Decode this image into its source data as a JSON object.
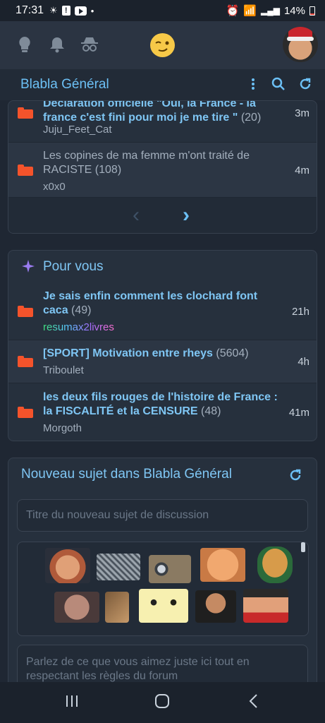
{
  "status_bar": {
    "time": "17:31",
    "battery": "14%",
    "left_icons": [
      "sun-icon",
      "alert-icon",
      "youtube-icon",
      "dot-icon"
    ],
    "right_icons": [
      "alarm-icon",
      "wifi-icon",
      "signal-icon",
      "battery-icon"
    ]
  },
  "top_nav": {
    "icons": [
      "lightbulb-icon",
      "bell-icon",
      "incognito-icon",
      "smiley-logo-icon",
      "avatar"
    ]
  },
  "header": {
    "title": "Blabla Général",
    "actions": [
      "more-vert-icon",
      "search-icon",
      "refresh-icon"
    ]
  },
  "forum_topics": {
    "items": [
      {
        "title_line1": "Déclaration officielle \"Oui, la France - la",
        "title_line2": "france c'est fini pour moi je me tire \"",
        "count": "(20)",
        "author": "Juju_Feet_Cat",
        "age": "3m",
        "read": false
      },
      {
        "title_line1": "Les copines de ma femme m'ont traité de",
        "title_line2": "RACISTE",
        "count": "(108)",
        "author": "x0x0",
        "age": "4m",
        "read": true
      }
    ],
    "pager": {
      "prev": "‹",
      "next": "›"
    }
  },
  "for_you": {
    "title": "Pour vous",
    "items": [
      {
        "title_line1": "Je sais enfin comment les clochard font",
        "title_line2": "caca",
        "count": "(49)",
        "author": "resumax2livres",
        "age": "21h"
      },
      {
        "title_line1": "[SPORT] Motivation entre rheys",
        "title_line2": "",
        "count": "(5604)",
        "author": "Triboulet",
        "age": "4h"
      },
      {
        "title_line1": "les deux fils rouges de l'histoire de France :",
        "title_line2": "la FISCALITÉ et la CENSURE",
        "count": "(48)",
        "author": "Morgoth",
        "age": "41m"
      }
    ]
  },
  "new_topic": {
    "title": "Nouveau sujet dans Blabla Général",
    "title_placeholder": "Titre du nouveau sujet de discussion",
    "body_placeholder_line1": "Parlez de ce que vous aimez juste ici tout en",
    "body_placeholder_line2": "respectant les règles du forum"
  },
  "colors": {
    "accent": "#6cc0f5",
    "folder": "#f4532b",
    "background": "#1f2733",
    "card": "#26303d"
  }
}
